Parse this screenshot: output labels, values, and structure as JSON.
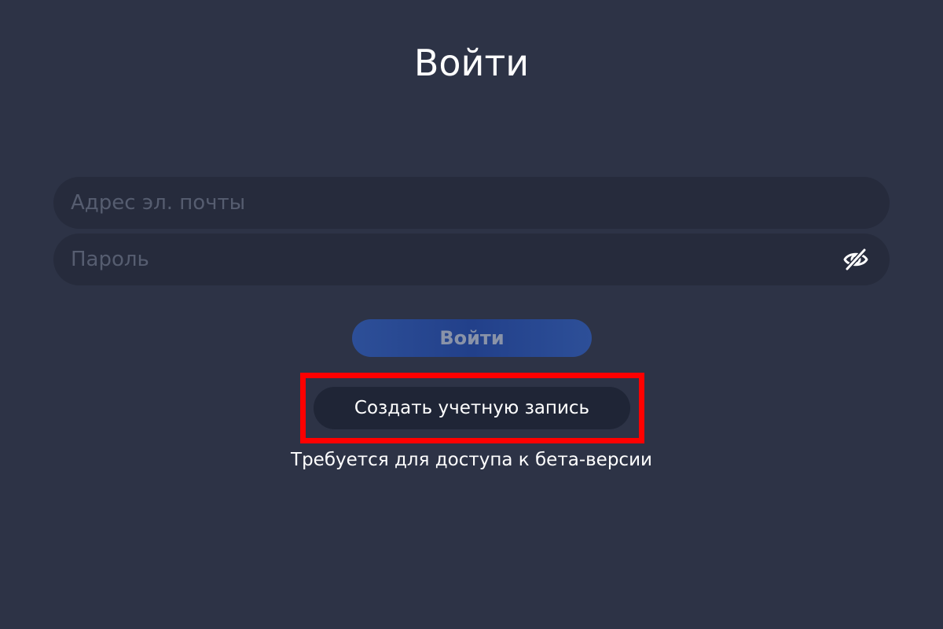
{
  "page": {
    "title": "Войти"
  },
  "form": {
    "email": {
      "value": "",
      "placeholder": "Адрес эл. почты"
    },
    "password": {
      "value": "",
      "placeholder": "Пароль",
      "toggle_icon": "eye-slash-icon"
    },
    "login_label": "Войти",
    "create_account_label": "Создать учетную запись",
    "beta_note": "Требуется для доступа к бета-версии"
  },
  "colors": {
    "background": "#2d3346",
    "field_background": "#262b3c",
    "primary_button": "#2d4f98",
    "secondary_button": "#1f2536",
    "highlight": "#ff0000"
  }
}
